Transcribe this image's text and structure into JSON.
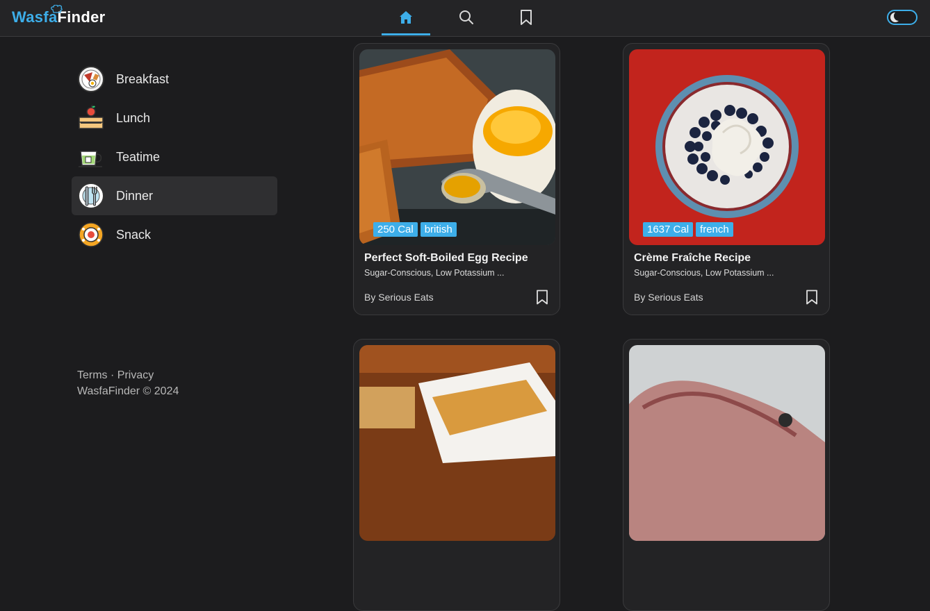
{
  "app": {
    "logo_part1": "Wasfa",
    "logo_part2": "Finder"
  },
  "nav": {
    "items": [
      {
        "icon": "home-icon",
        "active": true
      },
      {
        "icon": "search-icon",
        "active": false
      },
      {
        "icon": "bookmark-icon",
        "active": false
      }
    ],
    "theme_toggle": "dark-mode-toggle"
  },
  "sidebar": {
    "items": [
      {
        "label": "Breakfast",
        "icon": "breakfast-icon"
      },
      {
        "label": "Lunch",
        "icon": "lunch-icon"
      },
      {
        "label": "Teatime",
        "icon": "teatime-icon"
      },
      {
        "label": "Dinner",
        "icon": "dinner-icon",
        "active": true
      },
      {
        "label": "Snack",
        "icon": "snack-icon"
      }
    ]
  },
  "footer": {
    "terms": "Terms",
    "separator": " · ",
    "privacy": "Privacy",
    "copyright": "WasfaFinder © 2024"
  },
  "recipes": [
    {
      "title": "Perfect Soft-Boiled Egg Recipe",
      "labels": "Sugar-Conscious, Low Potassium ...",
      "source": "By Serious Eats",
      "calories": "250 Cal",
      "cuisine": "british"
    },
    {
      "title": "Crème Fraîche Recipe",
      "labels": "Sugar-Conscious, Low Potassium ...",
      "source": "By Serious Eats",
      "calories": "1637 Cal",
      "cuisine": "french"
    }
  ],
  "colors": {
    "accent": "#3daee9",
    "background": "#1c1c1e",
    "card": "#232325"
  }
}
